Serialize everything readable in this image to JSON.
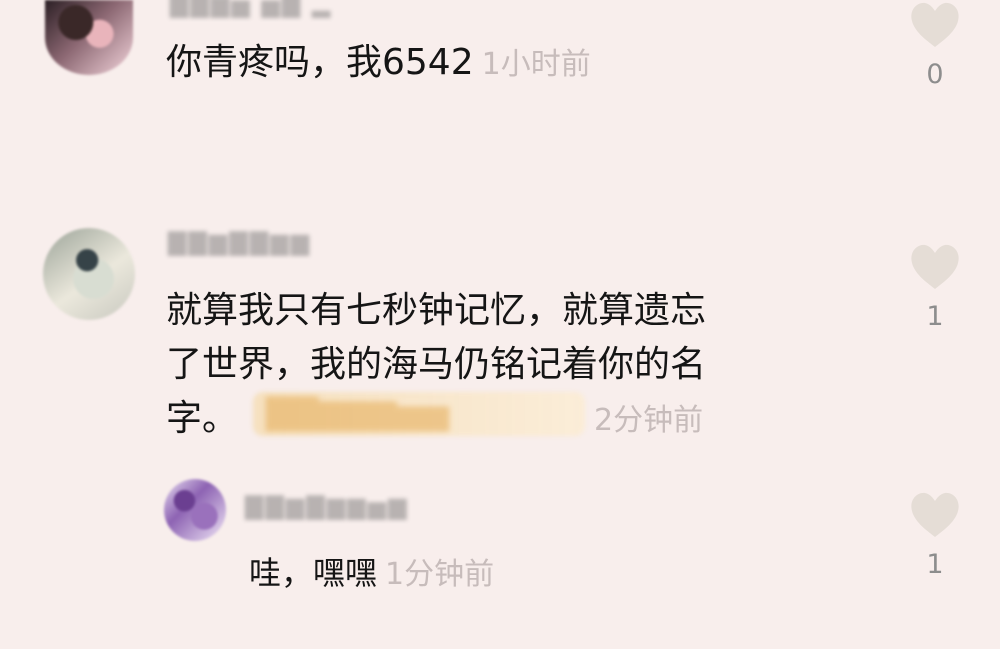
{
  "comments": [
    {
      "text": "你青疼吗，我6542",
      "time": "1小时前",
      "likes": "0"
    },
    {
      "text_lines": [
        "就算我只有七秒钟记忆，就算遗忘",
        "了世界，我的海马仍铭记着你的名",
        "字。"
      ],
      "time": "2分钟前",
      "likes": "1",
      "reply": {
        "text": "哇，嘿嘿",
        "time": "1分钟前",
        "likes": "1"
      }
    }
  ],
  "colors": {
    "background": "#f8eeec",
    "text": "#151515",
    "timestamp": "#c7bcbb",
    "heart": "#e5ddd6"
  },
  "icons": {
    "like": "heart-icon"
  }
}
